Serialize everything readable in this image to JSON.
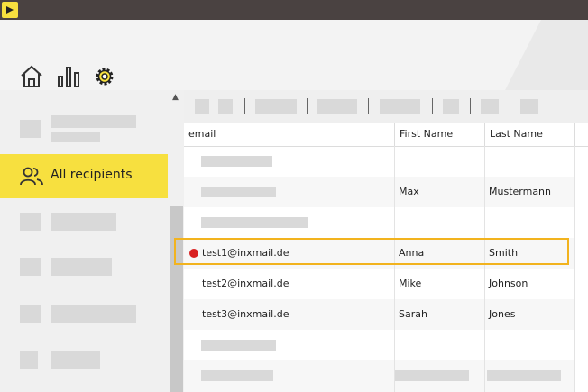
{
  "header": {
    "nav": [
      "home-icon",
      "chart-icon",
      "settings-icon"
    ]
  },
  "sidebar": {
    "active_item": {
      "label": "All recipients",
      "icon": "users-icon"
    }
  },
  "table": {
    "columns": [
      "email",
      "First Name",
      "Last Name"
    ],
    "rows": [
      {
        "email": "",
        "first": "",
        "last": ""
      },
      {
        "email": "",
        "first": "Max",
        "last": "Mustermann"
      },
      {
        "email": "",
        "first": "",
        "last": ""
      },
      {
        "email": "test1@inxmail.de",
        "first": "Anna",
        "last": "Smith",
        "selected": true
      },
      {
        "email": "test2@inxmail.de",
        "first": "Mike",
        "last": "Johnson"
      },
      {
        "email": "test3@inxmail.de",
        "first": "Sarah",
        "last": "Jones"
      },
      {
        "email": "",
        "first": "",
        "last": ""
      },
      {
        "email": "",
        "first": "",
        "last": ""
      }
    ]
  },
  "colors": {
    "accent": "#f7e03f",
    "selection_border": "#f2b31e",
    "status_dot": "#d92020"
  }
}
